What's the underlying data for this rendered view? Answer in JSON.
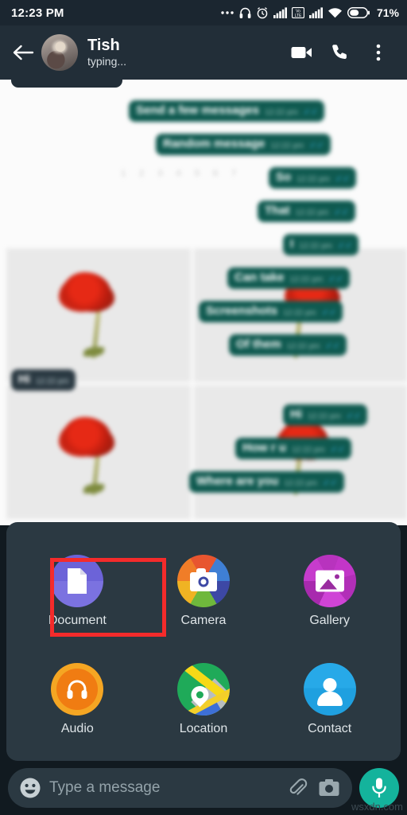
{
  "status_bar": {
    "time": "12:23 PM",
    "battery_percent": "71%",
    "icons": [
      "more-dots-icon",
      "headphones-icon",
      "alarm-icon",
      "signal-bars-icon",
      "volte-icon",
      "signal-bars-2-icon",
      "wifi-icon",
      "battery-icon"
    ],
    "volte_label": "VoLTE"
  },
  "header": {
    "contact_name": "Tish",
    "contact_status": "typing...",
    "back_icon": "back-arrow-icon",
    "video_call_icon": "video-call-icon",
    "voice_call_icon": "phone-call-icon",
    "overflow_icon": "more-vertical-icon"
  },
  "chat": {
    "timestamp_row": "1  2  3  4  5  6  7",
    "messages": [
      {
        "text": "Send a few messages",
        "time": "12:22 pm",
        "direction": "out",
        "status": "read"
      },
      {
        "text": "Random message",
        "time": "12:22 pm",
        "direction": "out",
        "status": "read"
      },
      {
        "text": "So",
        "time": "12:22 pm",
        "direction": "out",
        "status": "read"
      },
      {
        "text": "That",
        "time": "12:22 pm",
        "direction": "out",
        "status": "read"
      },
      {
        "text": "I",
        "time": "12:22 pm",
        "direction": "out",
        "status": "read"
      },
      {
        "text": "Can take",
        "time": "12:22 pm",
        "direction": "out",
        "status": "read"
      },
      {
        "text": "Screenshots",
        "time": "12:22 pm",
        "direction": "out",
        "status": "read"
      },
      {
        "text": "Of them",
        "time": "12:22 pm",
        "direction": "out",
        "status": "read"
      },
      {
        "text": "Hi",
        "time": "12:22 pm",
        "direction": "in",
        "status": "none"
      },
      {
        "text": "Hi",
        "time": "12:22 pm",
        "direction": "out",
        "status": "read"
      },
      {
        "text": "How r u",
        "time": "12:22 pm",
        "direction": "out",
        "status": "read"
      },
      {
        "text": "Where are you",
        "time": "12:22 pm",
        "direction": "out",
        "status": "read"
      }
    ]
  },
  "attach_panel": {
    "items": [
      {
        "label": "Document",
        "icon": "document-icon",
        "color": "#6c63d8",
        "highlighted": true
      },
      {
        "label": "Camera",
        "icon": "camera-icon",
        "color": "#e8552f",
        "highlighted": false
      },
      {
        "label": "Gallery",
        "icon": "gallery-icon",
        "color": "#c236c8",
        "highlighted": false
      },
      {
        "label": "Audio",
        "icon": "audio-icon",
        "color": "#f5a623",
        "highlighted": false
      },
      {
        "label": "Location",
        "icon": "location-icon",
        "color": "#1faa59",
        "highlighted": false
      },
      {
        "label": "Contact",
        "icon": "contact-icon",
        "color": "#27a9e8",
        "highlighted": false
      }
    ],
    "highlight_color": "#f42b2b"
  },
  "input_bar": {
    "placeholder": "Type a message",
    "value": "",
    "emoji_icon": "emoji-smiley-icon",
    "attach_icon": "paperclip-icon",
    "camera_icon": "camera-icon",
    "mic_icon": "microphone-icon",
    "mic_color": "#14b39c"
  },
  "watermark": {
    "text": "wsxdn.com"
  }
}
